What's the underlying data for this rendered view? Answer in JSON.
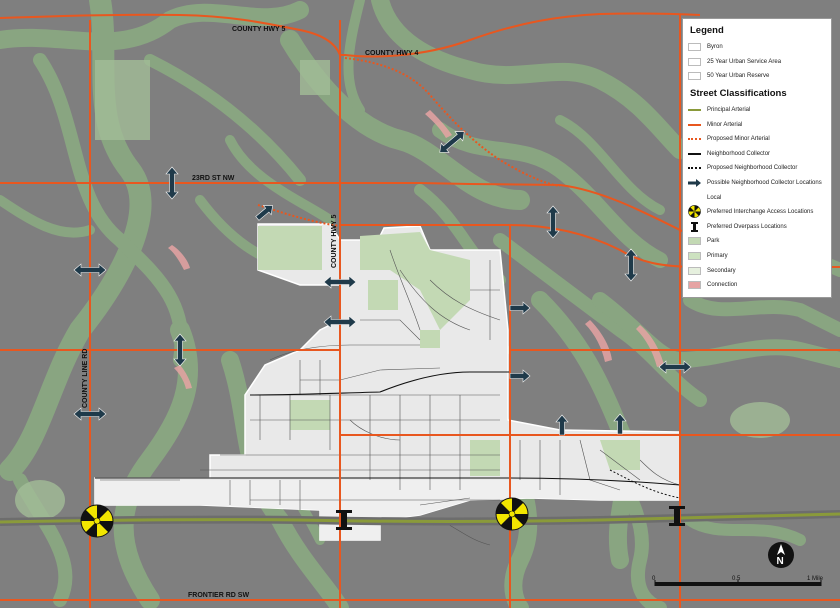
{
  "map": {
    "roads": {
      "county_hwy_5_top": "COUNTY HWY 5",
      "county_hwy_4": "COUNTY HWY 4",
      "rd_23_nw": "23RD ST NW",
      "county_hwy_5_vertical": "COUNTY HWY 5",
      "county_line_rd": "COUNTY LINE RD",
      "frontier_rd_sw": "FRONTIER RD SW"
    },
    "colors": {
      "background": "#7f7f7f",
      "natural_area": "#8aa882",
      "park": "#c3d9b4",
      "primary": "#cde2c0",
      "secondary": "#e6f0de",
      "connection": "#e6a3a3",
      "urban": "#e9e9e9",
      "minor_arterial": "#e8571f",
      "principal_arterial": "#8a9a3a",
      "arrow": "#1f3a4a"
    }
  },
  "legend": {
    "title": "Legend",
    "items": [
      {
        "label": "Byron",
        "swatch": "box",
        "color": "#ffffff"
      },
      {
        "label": "25 Year Urban Service Area",
        "swatch": "box",
        "color": "#ffffff"
      },
      {
        "label": "50 Year Urban Reserve",
        "swatch": "box",
        "color": "#ffffff"
      }
    ],
    "street_title": "Street Classifications",
    "street_items": [
      {
        "label": "Principal Arterial",
        "swatch": "line",
        "color": "#8a9a3a"
      },
      {
        "label": "Minor Arterial",
        "swatch": "line",
        "color": "#e8571f"
      },
      {
        "label": "Proposed Minor Arterial",
        "swatch": "dotted",
        "color": "#e8571f"
      },
      {
        "label": "Neighborhood Collector",
        "swatch": "line",
        "color": "#111111"
      },
      {
        "label": "Proposed Neighborhood Collector",
        "swatch": "dotted",
        "color": "#111111"
      },
      {
        "label": "Possible Neighborhood Collector Locations",
        "swatch": "arrow",
        "color": "#1f3a4a"
      },
      {
        "label": "Local",
        "swatch": "none",
        "color": "#ffffff"
      },
      {
        "label": "Preferred Interchange Access Locations",
        "swatch": "interchange",
        "color": "#f2e600"
      },
      {
        "label": "Preferred Overpass Locations",
        "swatch": "overpass",
        "color": "#111111"
      },
      {
        "label": "Park",
        "swatch": "box",
        "color": "#c3d9b4"
      },
      {
        "label": "Primary",
        "swatch": "box",
        "color": "#cde2c0"
      },
      {
        "label": "Secondary",
        "swatch": "box",
        "color": "#e6f0de"
      },
      {
        "label": "Connection",
        "swatch": "box",
        "color": "#e6a3a3"
      }
    ]
  },
  "scale": {
    "labels": [
      "0",
      "0.5",
      "1 Mile"
    ]
  },
  "north": {
    "label": "N"
  }
}
